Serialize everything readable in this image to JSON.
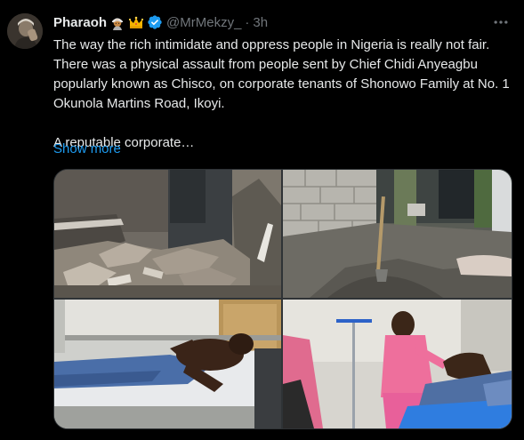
{
  "tweet": {
    "author": {
      "display_name": "Pharaoh",
      "badges": [
        "man-with-turban-emoji",
        "crown-emoji",
        "verified-badge-icon"
      ],
      "handle": "@MrMekzy_",
      "separator": "·",
      "time": "3h"
    },
    "text": {
      "para1": "The way the rich intimidate and oppress people in Nigeria is really not fair. There was a physical assault from people sent by Chief Chidi Anyeagbu popularly known as Chisco, on corporate tenants of Shonowo Family at No. 1 Okunola Martins Road, Ikoyi.",
      "para2": "A reputable corporate…"
    },
    "show_more_label": "Show more",
    "media": {
      "photos": [
        {
          "name": "photo-rubble"
        },
        {
          "name": "photo-dug-ground"
        },
        {
          "name": "photo-hospital-patient"
        },
        {
          "name": "photo-nurse-attending"
        }
      ]
    },
    "colors": {
      "background": "#000000",
      "text": "#e7e9ea",
      "muted": "#71767b",
      "link": "#1d9bf0",
      "border": "#2f3336"
    }
  }
}
